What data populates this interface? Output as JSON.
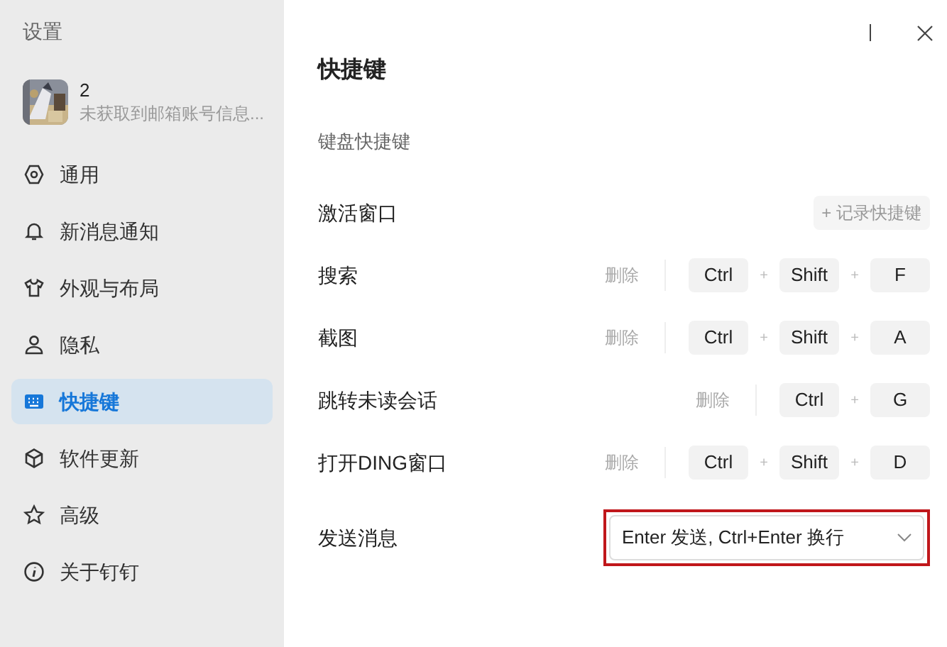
{
  "sidebar": {
    "title": "设置",
    "profile": {
      "name": "2",
      "subtitle": "未获取到邮箱账号信息..."
    },
    "items": [
      {
        "label": "通用",
        "selected": false
      },
      {
        "label": "新消息通知",
        "selected": false
      },
      {
        "label": "外观与布局",
        "selected": false
      },
      {
        "label": "隐私",
        "selected": false
      },
      {
        "label": "快捷键",
        "selected": true
      },
      {
        "label": "软件更新",
        "selected": false
      },
      {
        "label": "高级",
        "selected": false
      },
      {
        "label": "关于钉钉",
        "selected": false
      }
    ]
  },
  "content": {
    "title": "快捷键",
    "section": "键盘快捷键",
    "rows": [
      {
        "kind": "record",
        "label": "激活窗口",
        "action": "+ 记录快捷键"
      },
      {
        "kind": "keys",
        "label": "搜索",
        "delete": "删除",
        "keys": [
          "Ctrl",
          "Shift",
          "F"
        ],
        "separator": "+"
      },
      {
        "kind": "keys",
        "label": "截图",
        "delete": "删除",
        "keys": [
          "Ctrl",
          "Shift",
          "A"
        ],
        "separator": "+"
      },
      {
        "kind": "keys",
        "label": "跳转未读会话",
        "delete": "删除",
        "keys": [
          "Ctrl",
          "G"
        ],
        "separator": "+"
      },
      {
        "kind": "keys",
        "label": "打开DING窗口",
        "delete": "删除",
        "keys": [
          "Ctrl",
          "Shift",
          "D"
        ],
        "separator": "+"
      },
      {
        "kind": "select",
        "label": "发送消息",
        "value": "Enter 发送, Ctrl+Enter 换行",
        "highlighted": true
      }
    ]
  }
}
